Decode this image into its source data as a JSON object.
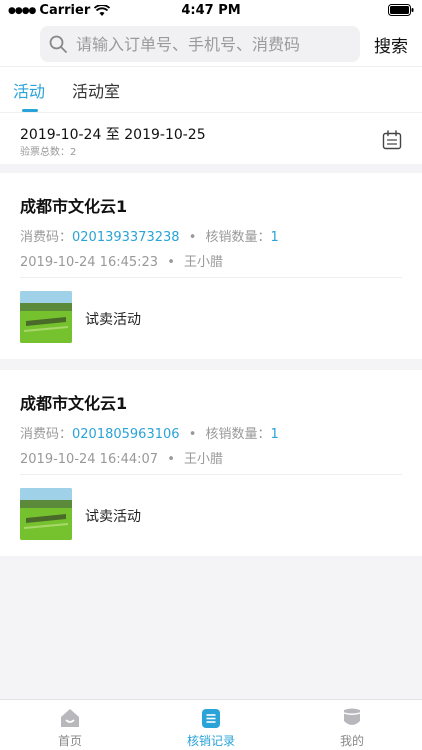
{
  "status_bar": {
    "carrier": "Carrier",
    "time": "4:47 PM"
  },
  "search": {
    "placeholder": "请输入订单号、手机号、消费码",
    "button_label": "搜索"
  },
  "tabs": [
    {
      "label": "活动",
      "active": true
    },
    {
      "label": "活动室",
      "active": false
    }
  ],
  "filter": {
    "date_range": "2019-10-24 至 2019-10-25",
    "ticket_total": "验票总数：2"
  },
  "records": [
    {
      "title": "成都市文化云1",
      "code_label": "消费码：",
      "code": "0201393373238",
      "qty_label": "核销数量：",
      "qty": "1",
      "time": "2019-10-24 16:45:23",
      "operator": "王小腊",
      "activity": "试卖活动"
    },
    {
      "title": "成都市文化云1",
      "code_label": "消费码：",
      "code": "0201805963106",
      "qty_label": "核销数量：",
      "qty": "1",
      "time": "2019-10-24 16:44:07",
      "operator": "王小腊",
      "activity": "试卖活动"
    }
  ],
  "separator": "•",
  "tabbar": [
    {
      "label": "首页",
      "icon": "home-icon",
      "active": false
    },
    {
      "label": "核销记录",
      "icon": "records-icon",
      "active": true
    },
    {
      "label": "我的",
      "icon": "profile-icon",
      "active": false
    }
  ],
  "colors": {
    "accent": "#2aa3d8",
    "muted": "#999999",
    "background": "#f4f4f6"
  }
}
